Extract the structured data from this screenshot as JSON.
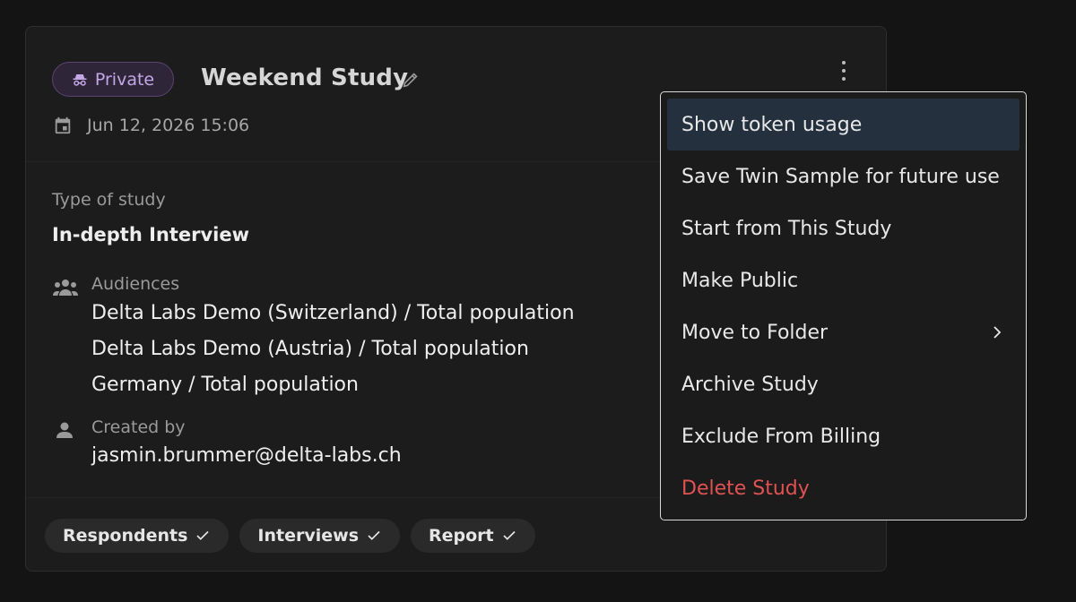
{
  "study": {
    "badge": "Private",
    "title": "Weekend Study",
    "date": "Jun 12, 2026 15:06",
    "type_label": "Type of study",
    "type_value": "In-depth Interview",
    "audiences_label": "Audiences",
    "audiences": [
      "Delta Labs Demo (Switzerland) / Total population",
      "Delta Labs Demo (Austria) / Total population",
      "Germany / Total population"
    ],
    "created_label": "Created by",
    "created_by": "jasmin.brummer@delta-labs.ch"
  },
  "chips": [
    {
      "label": "Respondents",
      "icon": "check-icon"
    },
    {
      "label": "Interviews",
      "icon": "check-icon"
    },
    {
      "label": "Report",
      "icon": "check-icon"
    }
  ],
  "menu": {
    "items": [
      {
        "label": "Show token usage",
        "state": "highlighted"
      },
      {
        "label": "Save Twin Sample for future use"
      },
      {
        "label": "Start from This Study"
      },
      {
        "label": "Make Public"
      },
      {
        "label": "Move to Folder",
        "icon": "chevron-right-icon"
      },
      {
        "label": "Archive Study"
      },
      {
        "label": "Exclude From Billing"
      },
      {
        "label": "Delete Study",
        "color": "#e05252"
      }
    ]
  },
  "colors": {
    "background": "#141414",
    "card": "#1c1c1c",
    "badge_accent": "#c4a7e7",
    "highlight": "#25303f",
    "danger": "#e05252"
  },
  "icons": [
    "incognito-icon",
    "pencil-icon",
    "kebab-menu-icon",
    "calendar-icon",
    "people-icon",
    "person-icon",
    "check-icon",
    "chevron-right-icon"
  ]
}
